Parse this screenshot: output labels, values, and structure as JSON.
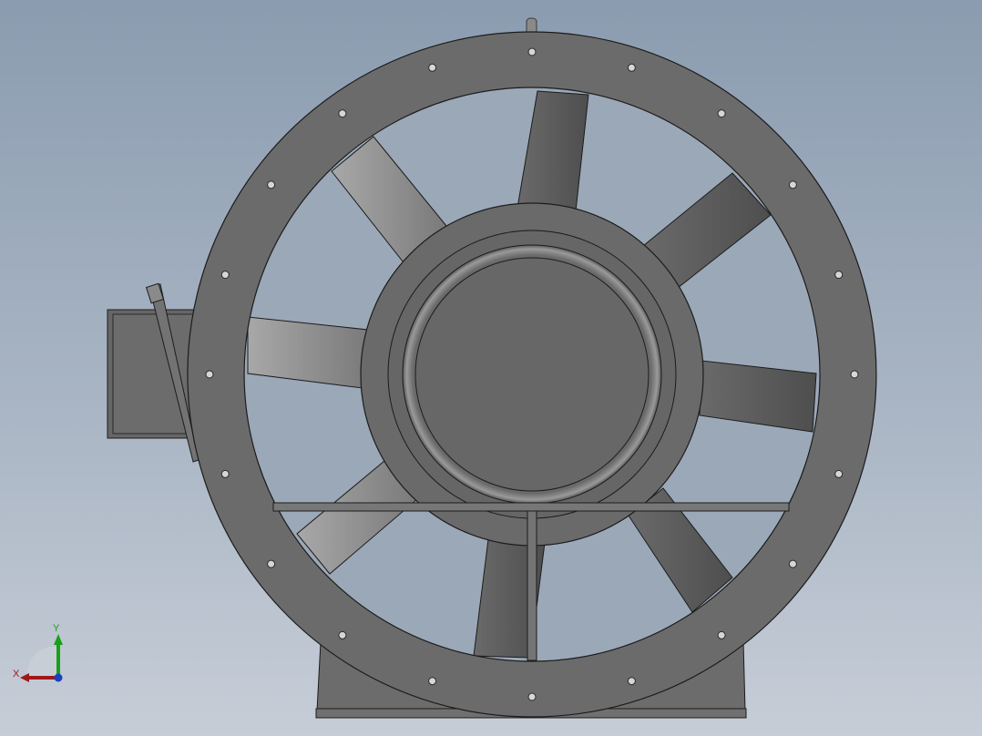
{
  "viewport": {
    "background_top": "#8b9cb0",
    "background_bottom": "#c6cdd7"
  },
  "model": {
    "part_color": "#6a6a6a",
    "edge_color": "#1c1c1c",
    "blade_count": 8
  },
  "triad": {
    "x_label": "X",
    "y_label": "Y",
    "x_color": "#a01818",
    "y_color": "#18a018",
    "z_color": "#1840c0"
  }
}
